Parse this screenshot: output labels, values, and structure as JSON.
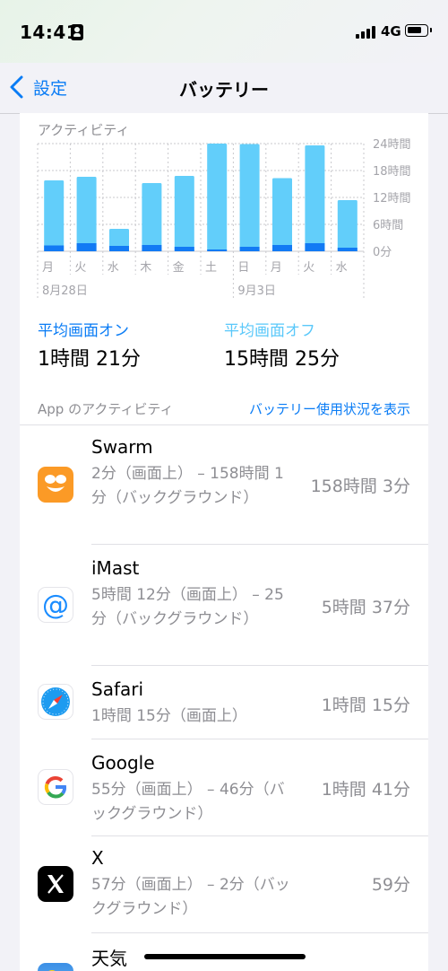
{
  "status_bar": {
    "time": "14:41",
    "network": "4G"
  },
  "nav": {
    "back_label": "設定",
    "title": "バッテリー"
  },
  "activity": {
    "section_label": "アクティビティ",
    "chart_data": {
      "type": "bar",
      "categories": [
        "月",
        "火",
        "水",
        "木",
        "金",
        "土",
        "日",
        "月",
        "火",
        "水"
      ],
      "date_labels": [
        "8月28日",
        "9月3日"
      ],
      "series": [
        {
          "values": [
            15.8,
            16.6,
            5.0,
            15.2,
            16.8,
            24.0,
            23.9,
            16.3,
            23.6,
            11.4
          ]
        },
        {
          "values": [
            1.3,
            1.8,
            1.2,
            1.4,
            1.0,
            0.4,
            1.0,
            1.4,
            1.8,
            0.8
          ]
        }
      ],
      "y_ticks": [
        "24時間",
        "18時間",
        "12時間",
        "6時間",
        "0分"
      ],
      "ylim": [
        0,
        24
      ],
      "colors": {
        "background": "#62cefa",
        "screen_on": "#127af4"
      },
      "grid": true
    },
    "avg_on_label": "平均画面オン",
    "avg_on_value": "1時間 21分",
    "avg_off_label": "平均画面オフ",
    "avg_off_value": "15時間 25分",
    "colors": {
      "avg_on": "#0a7cf5",
      "avg_off": "#5ac8fa"
    }
  },
  "app_activity": {
    "section_label": "App のアクティビティ",
    "show_usage_link": "バッテリー使用状況を表示",
    "apps": [
      {
        "name": "Swarm",
        "detail": "2分（画面上） – 158時間 1分（バックグラウンド）",
        "total": "158時間 3分",
        "icon": "swarm-icon"
      },
      {
        "name": "iMast",
        "detail": "5時間 12分（画面上） – 25分（バックグラウンド）",
        "total": "5時間 37分",
        "icon": "imast-icon"
      },
      {
        "name": "Safari",
        "detail": "1時間 15分（画面上）",
        "total": "1時間 15分",
        "icon": "safari-icon"
      },
      {
        "name": "Google",
        "detail": "55分（画面上） – 46分（バックグラウンド）",
        "total": "1時間 41分",
        "icon": "google-icon"
      },
      {
        "name": "X",
        "detail": "57分（画面上） – 2分（バックグラウンド）",
        "total": "59分",
        "icon": "x-icon"
      },
      {
        "name": "天気",
        "detail": "",
        "total": "",
        "icon": "weather-icon"
      }
    ]
  }
}
